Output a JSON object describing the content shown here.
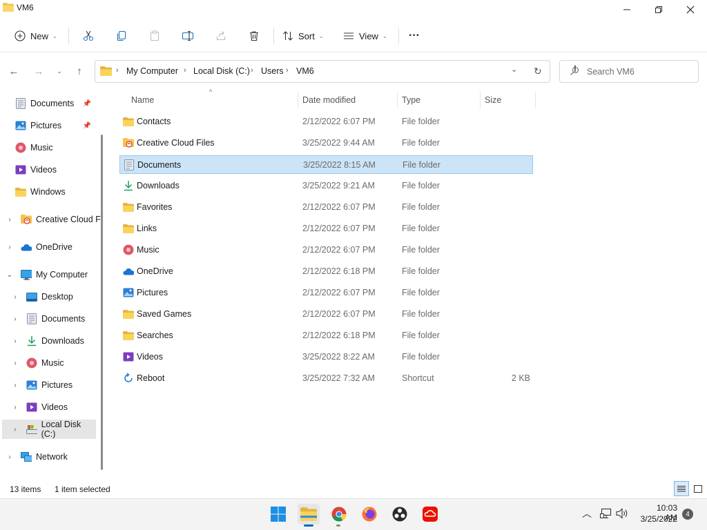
{
  "window": {
    "title": "VM6"
  },
  "command_bar": {
    "new_label": "New",
    "sort_label": "Sort",
    "view_label": "View",
    "more_label": "···"
  },
  "address": {
    "crumbs": [
      "My Computer",
      "Local Disk (C:)",
      "Users",
      "VM6"
    ],
    "search_placeholder": "Search VM6"
  },
  "nav_pane": {
    "items": [
      {
        "label": "Documents",
        "icon": "documents-icon",
        "pinned": true
      },
      {
        "label": "Pictures",
        "icon": "pictures-icon",
        "pinned": true
      },
      {
        "label": "Music",
        "icon": "music-icon",
        "pinned": false
      },
      {
        "label": "Videos",
        "icon": "videos-icon",
        "pinned": false
      },
      {
        "label": "Windows",
        "icon": "folder-icon",
        "pinned": false
      },
      {
        "label": "Creative Cloud F",
        "icon": "creative-cloud-icon"
      },
      {
        "label": "OneDrive",
        "icon": "onedrive-icon"
      },
      {
        "label": "My Computer",
        "icon": "computer-icon"
      },
      {
        "label": "Desktop",
        "icon": "desktop-icon"
      },
      {
        "label": "Documents",
        "icon": "documents-icon"
      },
      {
        "label": "Downloads",
        "icon": "downloads-icon"
      },
      {
        "label": "Music",
        "icon": "music-icon"
      },
      {
        "label": "Pictures",
        "icon": "pictures-icon"
      },
      {
        "label": "Videos",
        "icon": "videos-icon"
      },
      {
        "label": "Local Disk (C:)",
        "icon": "local-disk-icon"
      },
      {
        "label": "Network",
        "icon": "network-icon"
      }
    ]
  },
  "list": {
    "columns": {
      "name": "Name",
      "date": "Date modified",
      "type": "Type",
      "size": "Size"
    },
    "rows": [
      {
        "name": "Contacts",
        "date": "2/12/2022 6:07 PM",
        "type": "File folder",
        "size": "",
        "icon": "folder-icon"
      },
      {
        "name": "Creative Cloud Files",
        "date": "3/25/2022 9:44 AM",
        "type": "File folder",
        "size": "",
        "icon": "creative-cloud-icon"
      },
      {
        "name": "Documents",
        "date": "3/25/2022 8:15 AM",
        "type": "File folder",
        "size": "",
        "icon": "documents-icon"
      },
      {
        "name": "Downloads",
        "date": "3/25/2022 9:21 AM",
        "type": "File folder",
        "size": "",
        "icon": "downloads-icon"
      },
      {
        "name": "Favorites",
        "date": "2/12/2022 6:07 PM",
        "type": "File folder",
        "size": "",
        "icon": "folder-icon"
      },
      {
        "name": "Links",
        "date": "2/12/2022 6:07 PM",
        "type": "File folder",
        "size": "",
        "icon": "folder-icon"
      },
      {
        "name": "Music",
        "date": "2/12/2022 6:07 PM",
        "type": "File folder",
        "size": "",
        "icon": "music-icon"
      },
      {
        "name": "OneDrive",
        "date": "2/12/2022 6:18 PM",
        "type": "File folder",
        "size": "",
        "icon": "onedrive-icon"
      },
      {
        "name": "Pictures",
        "date": "2/12/2022 6:07 PM",
        "type": "File folder",
        "size": "",
        "icon": "pictures-icon"
      },
      {
        "name": "Saved Games",
        "date": "2/12/2022 6:07 PM",
        "type": "File folder",
        "size": "",
        "icon": "folder-icon"
      },
      {
        "name": "Searches",
        "date": "2/12/2022 6:18 PM",
        "type": "File folder",
        "size": "",
        "icon": "folder-icon"
      },
      {
        "name": "Videos",
        "date": "3/25/2022 8:22 AM",
        "type": "File folder",
        "size": "",
        "icon": "videos-icon"
      },
      {
        "name": "Reboot",
        "date": "3/25/2022 7:32 AM",
        "type": "Shortcut",
        "size": "2 KB",
        "icon": "shortcut-icon"
      }
    ]
  },
  "status": {
    "items_count": "13 items",
    "selection": "1 item selected"
  },
  "taskbar": {
    "time": "10:03 AM",
    "date": "3/25/2022",
    "notification_count": "4"
  },
  "colors": {
    "accent": "#0067c0",
    "selection_bg": "#cce4f7",
    "folder": "#f4c54a"
  }
}
